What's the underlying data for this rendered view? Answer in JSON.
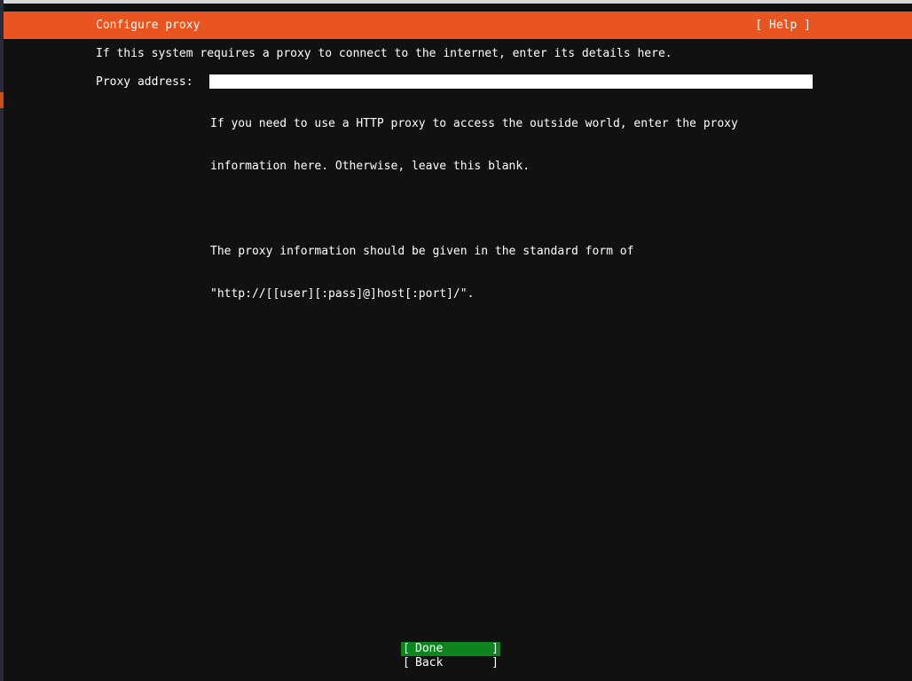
{
  "header": {
    "title": "Configure proxy",
    "help": "[ Help ]"
  },
  "intro_text": "If this system requires a proxy to connect to the internet, enter its details here.",
  "proxy": {
    "label": "Proxy address:",
    "value": "",
    "help_lines": [
      "If you need to use a HTTP proxy to access the outside world, enter the proxy",
      "information here. Otherwise, leave this blank.",
      "",
      "The proxy information should be given in the standard form of",
      "\"http://[[user][:pass]@]host[:port]/\"."
    ]
  },
  "buttons": {
    "bracket_open": "[",
    "bracket_close": "]",
    "done": "Done",
    "back": "Back"
  },
  "colors": {
    "header_bg": "#e95420",
    "background": "#111111",
    "done_bg": "#0e8420",
    "text": "#ffffff"
  }
}
